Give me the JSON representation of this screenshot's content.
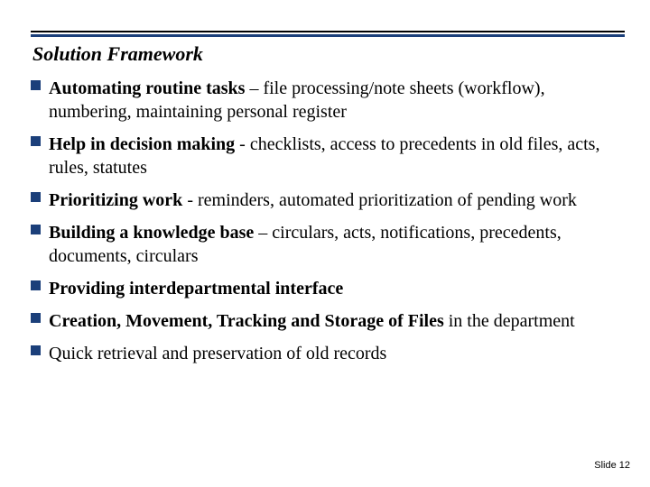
{
  "title": "Solution Framework",
  "bullets": [
    {
      "lead": "Automating routine tasks",
      "rest": " – file processing/note sheets (workflow), numbering, maintaining personal register"
    },
    {
      "lead": "Help in decision making",
      "rest": " - checklists, access to precedents in old files, acts, rules, statutes"
    },
    {
      "lead": "Prioritizing work",
      "rest": " - reminders, automated prioritization of pending work"
    },
    {
      "lead": "Building a knowledge base",
      "rest": " – circulars, acts, notifications, precedents, documents, circulars"
    },
    {
      "lead": "Providing interdepartmental interface",
      "rest": ""
    },
    {
      "lead": "Creation, Movement, Tracking and Storage of Files",
      "rest": " in the department"
    },
    {
      "lead": "",
      "rest": "Quick retrieval and preservation of old records"
    }
  ],
  "footer": "Slide 12"
}
